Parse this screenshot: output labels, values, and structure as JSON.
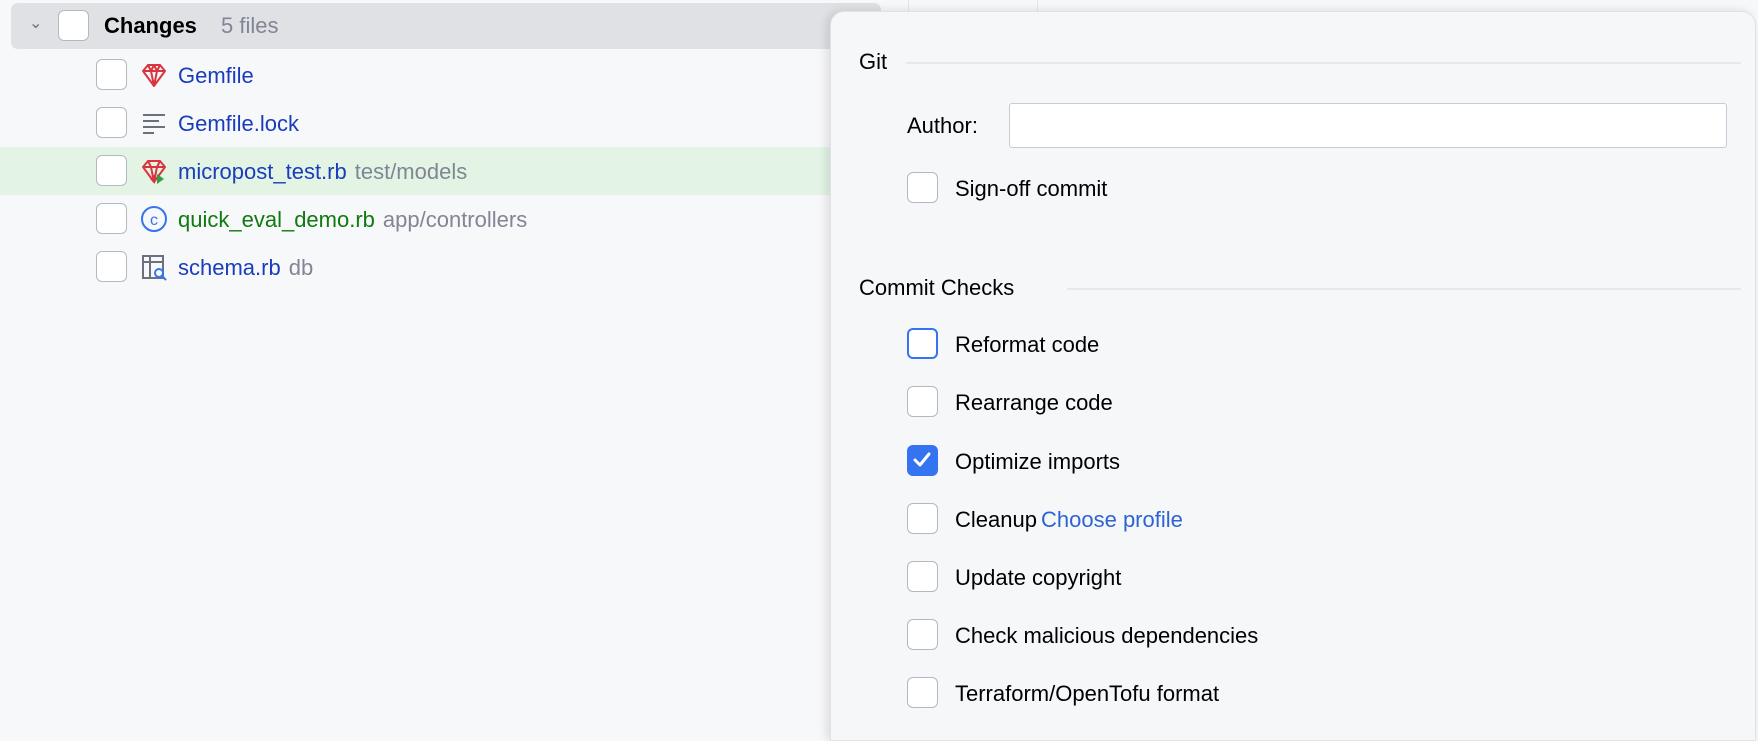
{
  "changes": {
    "title": "Changes",
    "count": "5 files",
    "files": [
      {
        "name": "Gemfile",
        "path": "",
        "icon": "ruby-gem-icon",
        "color": "blue"
      },
      {
        "name": "Gemfile.lock",
        "path": "",
        "icon": "text-file-icon",
        "color": "blue"
      },
      {
        "name": "micropost_test.rb",
        "path": "test/models",
        "icon": "ruby-test-icon",
        "color": "blue",
        "selected": true
      },
      {
        "name": "quick_eval_demo.rb",
        "path": "app/controllers",
        "icon": "class-icon",
        "color": "green"
      },
      {
        "name": "schema.rb",
        "path": "db",
        "icon": "db-schema-icon",
        "color": "blue"
      }
    ]
  },
  "popup": {
    "git": {
      "title": "Git",
      "author_label": "Author:",
      "author_value": "",
      "signoff": "Sign-off commit"
    },
    "checks": {
      "title": "Commit Checks",
      "items": [
        {
          "label": "Reformat code",
          "checked": false
        },
        {
          "label": "Rearrange code",
          "checked": false
        },
        {
          "label": "Optimize imports",
          "checked": true
        },
        {
          "label": "Cleanup",
          "checked": false,
          "link": "Choose profile"
        },
        {
          "label": "Update copyright",
          "checked": false
        },
        {
          "label": "Check malicious dependencies",
          "checked": false
        },
        {
          "label": "Terraform/OpenTofu format",
          "checked": false
        }
      ]
    }
  },
  "colors": {
    "accent": "#3574f0",
    "link": "#2e63d4",
    "ruby": "#d9343f",
    "added": "#107a10",
    "modified": "#1a3dbd"
  }
}
